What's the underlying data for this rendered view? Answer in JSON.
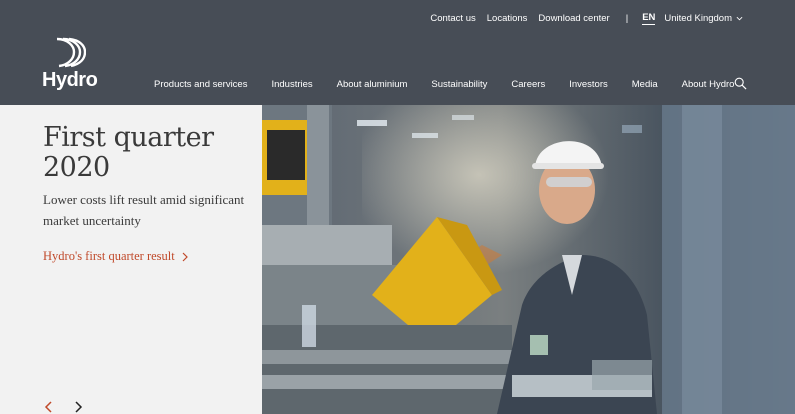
{
  "utility_nav": {
    "links": [
      "Contact us",
      "Locations",
      "Download center"
    ],
    "separator": "|",
    "language": "EN",
    "region": "United Kingdom"
  },
  "brand": {
    "name": "Hydro"
  },
  "main_nav": {
    "items": [
      "Products and services",
      "Industries",
      "About aluminium",
      "Sustainability",
      "Careers",
      "Investors",
      "Media",
      "About Hydro"
    ]
  },
  "hero": {
    "title": "First quarter 2020",
    "subtitle": "Lower costs lift result amid significant market uncertainty",
    "link_label": "Hydro's first quarter result",
    "accent_color": "#c0492a"
  },
  "colors": {
    "header_bg": "#474d56",
    "panel_bg": "#f2f2f2",
    "helmet": "#f4f4f4",
    "machine_yellow": "#e2b11a"
  },
  "icons": [
    "hydro-logo-icon",
    "chevron-down-icon",
    "search-icon",
    "chevron-right-icon",
    "arrow-left-icon",
    "arrow-right-icon"
  ]
}
